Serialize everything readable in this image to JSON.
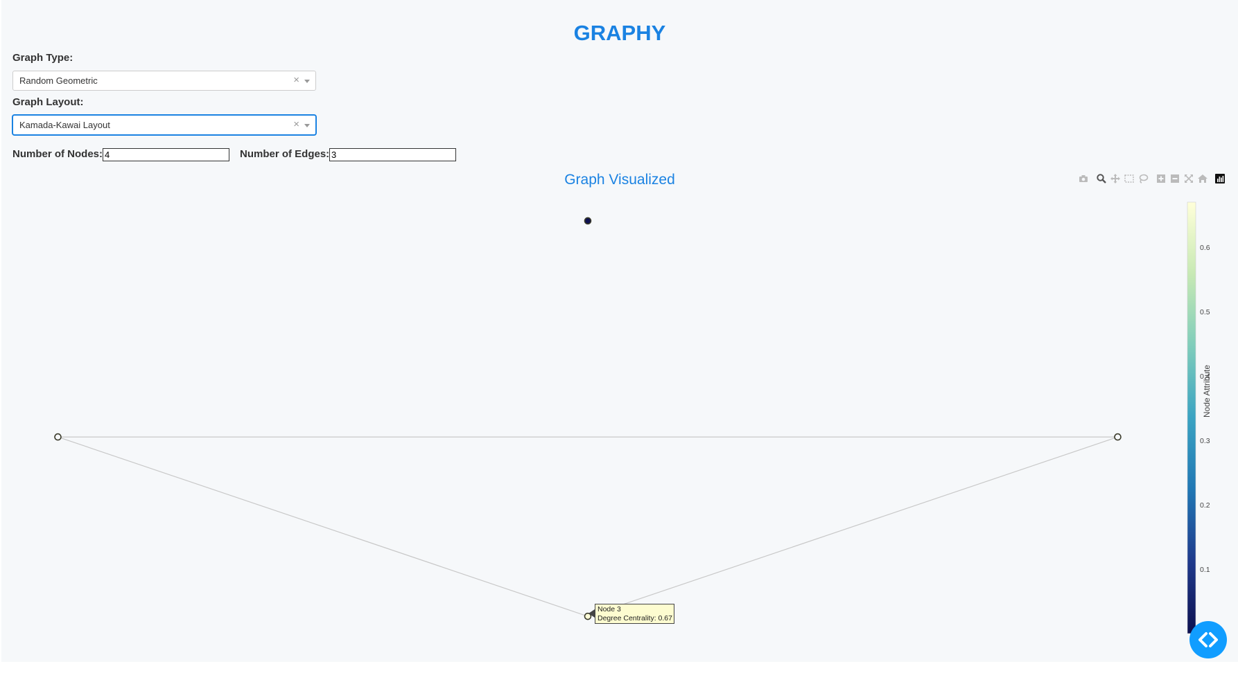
{
  "app": {
    "title": "GRAPHY"
  },
  "controls": {
    "graph_type": {
      "label": "Graph Type:",
      "value": "Random Geometric",
      "clear": "×"
    },
    "graph_layout": {
      "label": "Graph Layout:",
      "value": "Kamada-Kawai Layout",
      "clear": "×"
    },
    "num_nodes": {
      "label": "Number of Nodes:",
      "value": "4"
    },
    "num_edges": {
      "label": "Number of Edges:",
      "value": "3"
    }
  },
  "plot": {
    "title": "Graph Visualized",
    "modebar_icons": [
      "camera-icon",
      "zoom-icon",
      "pan-icon",
      "box-select-icon",
      "lasso-select-icon",
      "zoom-in-icon",
      "zoom-out-icon",
      "autoscale-icon",
      "reset-axes-icon",
      "plotly-logo-icon"
    ],
    "tooltip": {
      "line1": "Node 3",
      "line2": "Degree Centrality: 0.67"
    },
    "colorbar": {
      "title": "Node Attribute",
      "ticks": [
        "0.6",
        "0.5",
        "0.4",
        "0.3",
        "0.2",
        "0.1"
      ],
      "colorscale": [
        "#0d1150",
        "#1f3a8c",
        "#2077b4",
        "#3aa3c2",
        "#7fcdbb",
        "#c7e9b4",
        "#ffffd9"
      ],
      "range": [
        0,
        0.67
      ]
    }
  },
  "chart_data": {
    "type": "scatter",
    "title": "Graph Visualized",
    "xlabel": "",
    "ylabel": "",
    "grid": false,
    "nodes": [
      {
        "id": 0,
        "x": -1.0,
        "y": 0.0,
        "degree_centrality": 0.33
      },
      {
        "id": 1,
        "x": 1.0,
        "y": 0.0,
        "degree_centrality": 0.33
      },
      {
        "id": 2,
        "x": 0.0,
        "y": 1.0,
        "degree_centrality": 0.0
      },
      {
        "id": 3,
        "x": 0.0,
        "y": -0.83,
        "degree_centrality": 0.67
      }
    ],
    "edges": [
      [
        0,
        1
      ],
      [
        0,
        3
      ],
      [
        1,
        3
      ]
    ],
    "xlim": [
      -1.07,
      1.07
    ],
    "ylim": [
      -0.9,
      1.08
    ]
  },
  "code_toggle": {
    "icon": "code-icon"
  }
}
